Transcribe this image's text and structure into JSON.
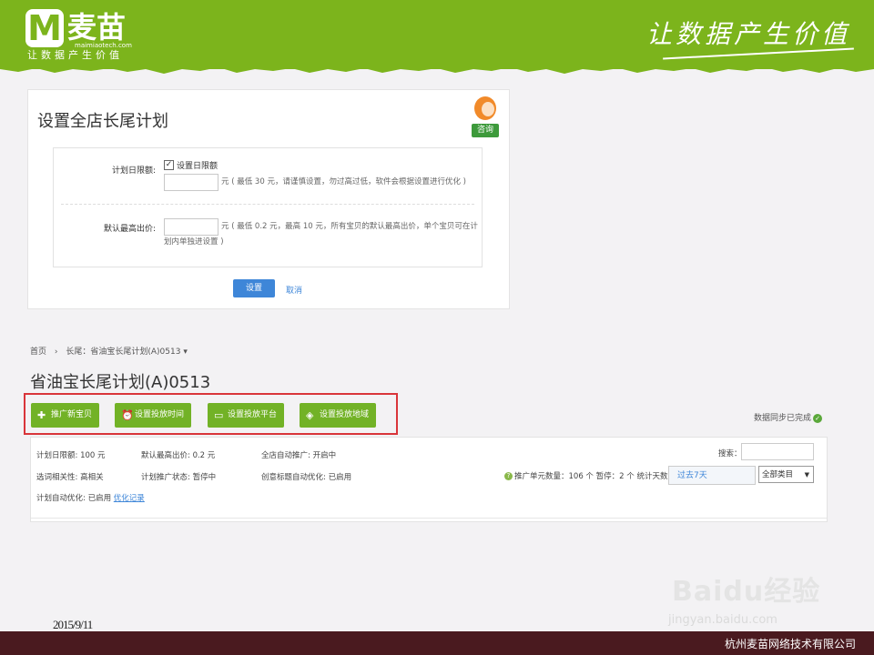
{
  "header": {
    "logo_letter": "M",
    "logo_name": "麦苗",
    "logo_url": "maimiaotech.com",
    "logo_slogan": "让数据产生价值",
    "slogan": "让数据产生价值"
  },
  "dialog": {
    "title": "设置全店长尾计划",
    "consult_label": "咨询",
    "daily_limit_label": "计划日限额:",
    "daily_limit_checkbox": "设置日限额",
    "daily_limit_note": "元 ( 最低 30 元，请谨慎设置，勿过高过低，软件会根据设置进行优化 )",
    "max_bid_label": "默认最高出价:",
    "max_bid_note_1": "元 ( 最低 0.2 元，最高 10 元，所有宝贝的默认最高出价，单个宝贝可在计",
    "max_bid_note_2": "划内单独进设置 )",
    "confirm_button": "设置",
    "cancel_link": "取消"
  },
  "breadcrumb": {
    "home": "首页",
    "current": "长尾：省油宝长尾计划(A)0513"
  },
  "plan": {
    "title": "省油宝长尾计划(A)0513",
    "actions": [
      {
        "label": "推广新宝贝",
        "icon": "plus-icon"
      },
      {
        "label": "设置投放时间",
        "icon": "clock-icon"
      },
      {
        "label": "设置投放平台",
        "icon": "monitor-icon"
      },
      {
        "label": "设置投放地域",
        "icon": "map-icon"
      }
    ],
    "sync_status": "数据同步已完成"
  },
  "info": {
    "daily_limit": "计划日限额: 100 元",
    "default_bid": "默认最高出价: 0.2 元",
    "auto_promote": "全店自动推广: 开启中",
    "relevance": "选词相关性: 高相关",
    "status": "计划推广状态: 暂停中",
    "creative_opt": "创意标题自动优化: 已启用",
    "auto_opt": "计划自动优化: 已启用",
    "opt_record": "优化记录",
    "search_label": "搜索：",
    "units": "推广单元数量：106 个  暂停：2 个  统计天数：",
    "period": "过去7天",
    "category": "全部类目"
  },
  "footer": {
    "date": "2015/9/11",
    "company": "杭州麦苗网络技术有限公司",
    "watermark": "Baidu经验",
    "watermark_url": "jingyan.baidu.com"
  },
  "colors": {
    "brand_green": "#7cb41c",
    "button_green": "#72b226",
    "highlight_red": "#d9353a",
    "link_blue": "#3e86d8",
    "footer_bg": "#4a1a1f"
  }
}
